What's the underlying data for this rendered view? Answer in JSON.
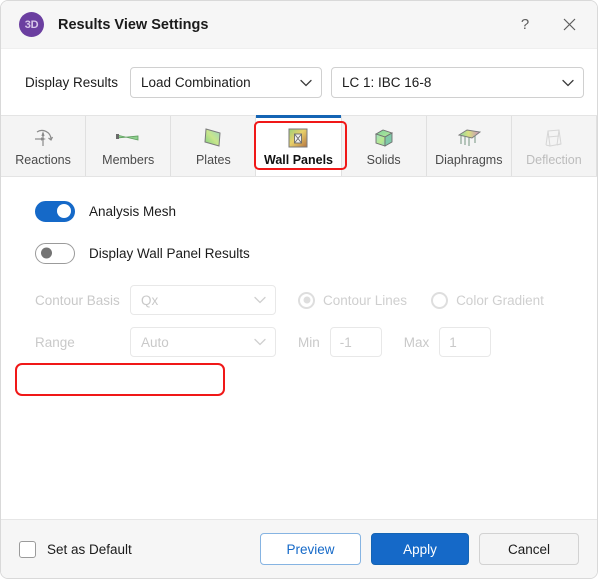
{
  "window": {
    "title": "Results View Settings",
    "icon": "3D",
    "icon_color": "#6b3fa0",
    "help_icon": "help-question-icon",
    "close_icon": "close-icon"
  },
  "display_results": {
    "label": "Display Results",
    "type_combo": {
      "value": "Load Combination",
      "icon": "chevron-down-icon"
    },
    "case_combo": {
      "value": "LC 1: IBC 16-8",
      "icon": "chevron-down-icon"
    }
  },
  "tabs": [
    {
      "label": "Reactions",
      "icon": "reactions-icon",
      "selected": false,
      "disabled": false
    },
    {
      "label": "Members",
      "icon": "members-icon",
      "selected": false,
      "disabled": false
    },
    {
      "label": "Plates",
      "icon": "plates-icon",
      "selected": false,
      "disabled": false
    },
    {
      "label": "Wall Panels",
      "icon": "wall-panels-icon",
      "selected": true,
      "disabled": false
    },
    {
      "label": "Solids",
      "icon": "solids-icon",
      "selected": false,
      "disabled": false
    },
    {
      "label": "Diaphragms",
      "icon": "diaphragms-icon",
      "selected": false,
      "disabled": false
    },
    {
      "label": "Deflection",
      "icon": "deflection-icon",
      "selected": false,
      "disabled": true
    }
  ],
  "options": {
    "analysis_mesh": {
      "label": "Analysis Mesh",
      "on": true,
      "highlighted": true
    },
    "display_wall_panel_results": {
      "label": "Display Wall Panel Results",
      "on": false
    },
    "contour_basis": {
      "label": "Contour Basis",
      "value": "Qx",
      "icon": "chevron-down-icon",
      "disabled": true
    },
    "contour_lines": {
      "label": "Contour Lines",
      "checked": true,
      "disabled": true
    },
    "color_gradient": {
      "label": "Color Gradient",
      "checked": false,
      "disabled": true
    },
    "range": {
      "label": "Range",
      "value": "Auto",
      "icon": "chevron-down-icon",
      "disabled": true
    },
    "min": {
      "label": "Min",
      "value": "-1",
      "disabled": true
    },
    "max": {
      "label": "Max",
      "value": "1",
      "disabled": true
    }
  },
  "footer": {
    "set_as_default": {
      "label": "Set as Default",
      "checked": false
    },
    "preview_label": "Preview",
    "apply_label": "Apply",
    "cancel_label": "Cancel"
  },
  "colors": {
    "accent": "#1569c8",
    "highlight": "#f01818",
    "tab_indicator": "#1464b4",
    "brand_purple": "#6b3fa0"
  }
}
